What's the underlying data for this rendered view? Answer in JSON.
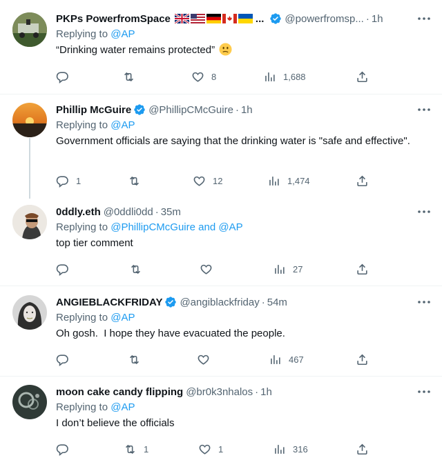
{
  "tweets": [
    {
      "name": "PKPs PowerfromSpace",
      "name_suffix": "...",
      "handle": "@powerfromsp...",
      "time": "1h",
      "replying_prefix": "Replying to",
      "replying_to": "@AP",
      "text": "“Drinking water remains protected”",
      "reply_count": "",
      "retweet_count": "",
      "like_count": "8",
      "view_count": "1,688"
    },
    {
      "name": "Phillip McGuire",
      "handle": "@PhillipCMcGuire",
      "time": "1h",
      "replying_prefix": "Replying to",
      "replying_to": "@AP",
      "text": "Government officials are saying that the drinking water is \"safe and effective\".",
      "reply_count": "1",
      "retweet_count": "",
      "like_count": "12",
      "view_count": "1,474"
    },
    {
      "name": "0ddly.eth",
      "handle": "@0ddli0dd",
      "time": "35m",
      "replying_prefix": "Replying to",
      "replying_to": "@PhillipCMcGuire and @AP",
      "text": "top tier comment",
      "reply_count": "",
      "retweet_count": "",
      "like_count": "",
      "view_count": "27"
    },
    {
      "name": "ANGIEBLACKFRIDAY",
      "handle": "@angiblackfriday",
      "time": "54m",
      "replying_prefix": "Replying to",
      "replying_to": "@AP",
      "text": "Oh gosh.  I hope they have evacuated the people.",
      "reply_count": "",
      "retweet_count": "",
      "like_count": "",
      "view_count": "467"
    },
    {
      "name": "moon cake candy flipping",
      "handle": "@br0k3nhalos",
      "time": "1h",
      "replying_prefix": "Replying to",
      "replying_to": "@AP",
      "text": "I don’t believe the officials",
      "reply_count": "",
      "retweet_count": "1",
      "like_count": "1",
      "view_count": "316"
    }
  ],
  "separator": "·",
  "colors": {
    "accent": "#1d9bf0",
    "secondary_text": "#536471",
    "primary_text": "#0f1419",
    "divider": "#eff3f4"
  },
  "icons": {
    "reply": "reply-icon",
    "retweet": "retweet-icon",
    "like": "heart-icon",
    "views": "views-icon",
    "share": "share-icon",
    "more": "more-icon",
    "verified": "verified-icon"
  }
}
